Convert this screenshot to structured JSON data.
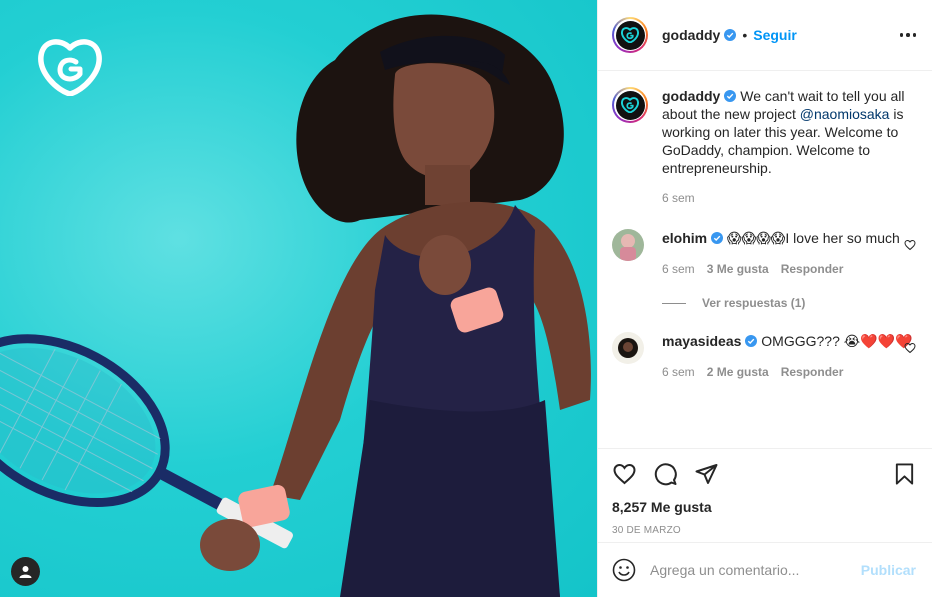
{
  "post": {
    "account": "godaddy",
    "follow_label": "Seguir",
    "separator": "•"
  },
  "caption": {
    "username": "godaddy",
    "text_before": "We can't wait to tell you all about the new project ",
    "mention": "@naomiosaka",
    "text_after": " is working on later this year. Welcome to GoDaddy, champion. Welcome to entrepreneurship.",
    "age": "6 sem"
  },
  "comments": [
    {
      "username": "elohim",
      "emoji": "😱😱😱😱",
      "text": "I love her so much",
      "age": "6 sem",
      "likes": "3 Me gusta",
      "reply_label": "Responder",
      "view_replies": "Ver respuestas (1)"
    },
    {
      "username": "mayasideas",
      "text": "OMGGG???",
      "emoji": "😭❤️❤️❤️",
      "age": "6 sem",
      "likes": "2 Me gusta",
      "reply_label": "Responder"
    }
  ],
  "stats": {
    "likes": "8,257 Me gusta",
    "date": "30 DE MARZO"
  },
  "composer": {
    "placeholder": "Agrega un comentario...",
    "publish_label": "Publicar"
  },
  "colors": {
    "photo_bg": "#1fcad0",
    "link_blue": "#0095f6",
    "verified_blue": "#3897f0",
    "heart_red": "#ed4956"
  },
  "icons": [
    "godaddy-logo",
    "verified-badge-icon",
    "more-options-icon",
    "heart-icon",
    "comment-icon",
    "share-icon",
    "bookmark-icon",
    "emoji-icon",
    "user-tag-icon"
  ]
}
